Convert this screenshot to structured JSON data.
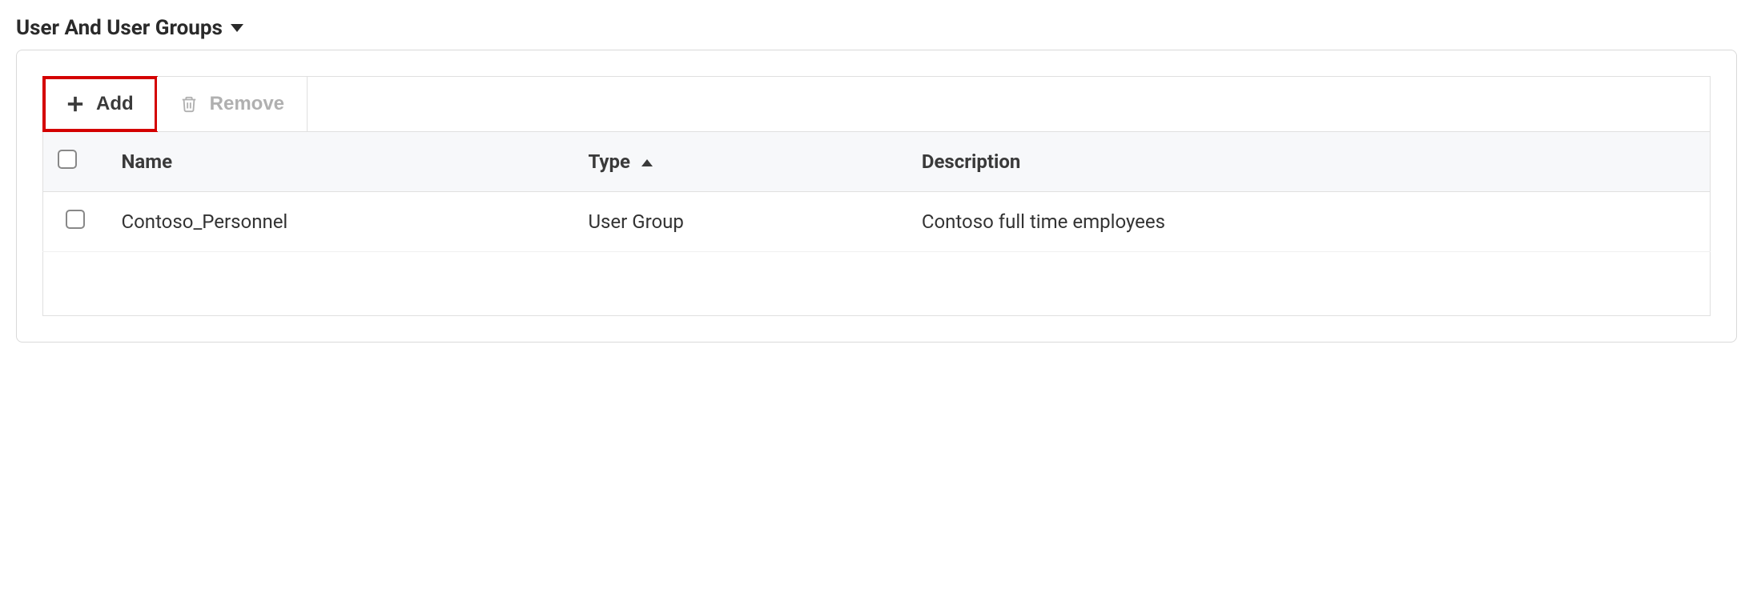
{
  "section": {
    "title": "User And User Groups"
  },
  "toolbar": {
    "add_label": "Add",
    "remove_label": "Remove"
  },
  "table": {
    "columns": {
      "name": "Name",
      "type": "Type",
      "description": "Description"
    },
    "rows": [
      {
        "name": "Contoso_Personnel",
        "type": "User Group",
        "description": "Contoso full time employees"
      }
    ]
  }
}
